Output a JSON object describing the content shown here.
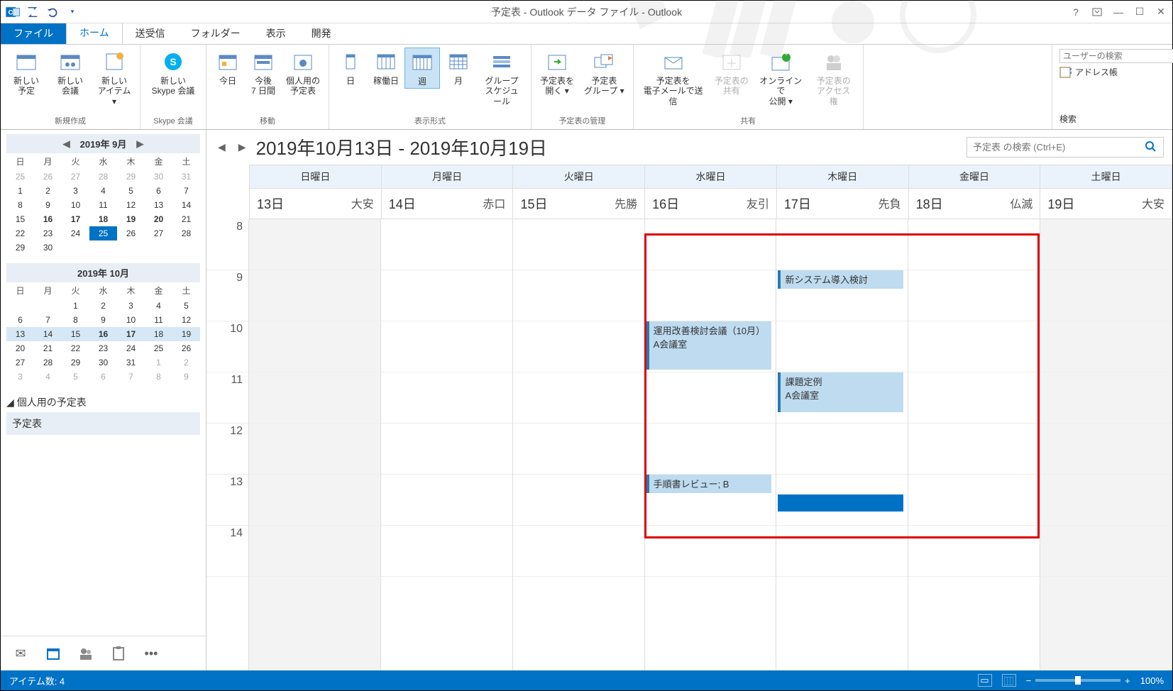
{
  "title": "予定表 - Outlook データ ファイル - Outlook",
  "tabs": {
    "file": "ファイル",
    "home": "ホーム",
    "sendrecv": "送受信",
    "folder": "フォルダー",
    "view": "表示",
    "dev": "開発"
  },
  "ribbon": {
    "new": {
      "appt": "新しい\n予定",
      "meeting": "新しい\n会議",
      "items": "新しい\nアイテム ▾",
      "label": "新規作成"
    },
    "skype": {
      "btn": "新しい\nSkype 会議",
      "label": "Skype 会議"
    },
    "move": {
      "today": "今日",
      "next7": "今後\n7 日間",
      "personal": "個人用の\n予定表",
      "label": "移動"
    },
    "arrange": {
      "day": "日",
      "work": "稼働日",
      "week": "週",
      "month": "月",
      "group": "グループ\nスケジュール",
      "label": "表示形式"
    },
    "manage": {
      "open": "予定表を\n開く ▾",
      "group": "予定表\nグループ ▾",
      "label": "予定表の管理"
    },
    "share": {
      "email": "予定表を\n電子メールで送信",
      "share": "予定表の\n共有",
      "publish": "オンラインで\n公開 ▾",
      "perm": "予定表の\nアクセス権",
      "label": "共有"
    },
    "find": {
      "search_ph": "ユーザーの検索",
      "addr": "アドレス帳",
      "label": "検索"
    }
  },
  "minicals": {
    "sep": {
      "title": "2019年 9月",
      "dow": [
        "日",
        "月",
        "火",
        "水",
        "木",
        "金",
        "土"
      ]
    },
    "oct": {
      "title": "2019年 10月"
    }
  },
  "calpane": {
    "header": "個人用の予定表",
    "item": "予定表"
  },
  "range": "2019年10月13日 - 2019年10月19日",
  "cal_search_ph": "予定表 の検索 (Ctrl+E)",
  "days": [
    "日曜日",
    "月曜日",
    "火曜日",
    "水曜日",
    "木曜日",
    "金曜日",
    "土曜日"
  ],
  "dates": [
    {
      "d": "13日",
      "r": "大安"
    },
    {
      "d": "14日",
      "r": "赤口"
    },
    {
      "d": "15日",
      "r": "先勝"
    },
    {
      "d": "16日",
      "r": "友引"
    },
    {
      "d": "17日",
      "r": "先負"
    },
    {
      "d": "18日",
      "r": "仏滅"
    },
    {
      "d": "19日",
      "r": "大安"
    }
  ],
  "hours": [
    "8",
    "9",
    "10",
    "11",
    "12",
    "13",
    "14"
  ],
  "events": {
    "e1": "新システム導入検討",
    "e2": "運用改善検討会議（10月）\nA会議室",
    "e3": "課題定例\nA会議室",
    "e4": "手順書レビュー; B"
  },
  "status": {
    "items": "アイテム数: 4",
    "zoom": "100%"
  }
}
